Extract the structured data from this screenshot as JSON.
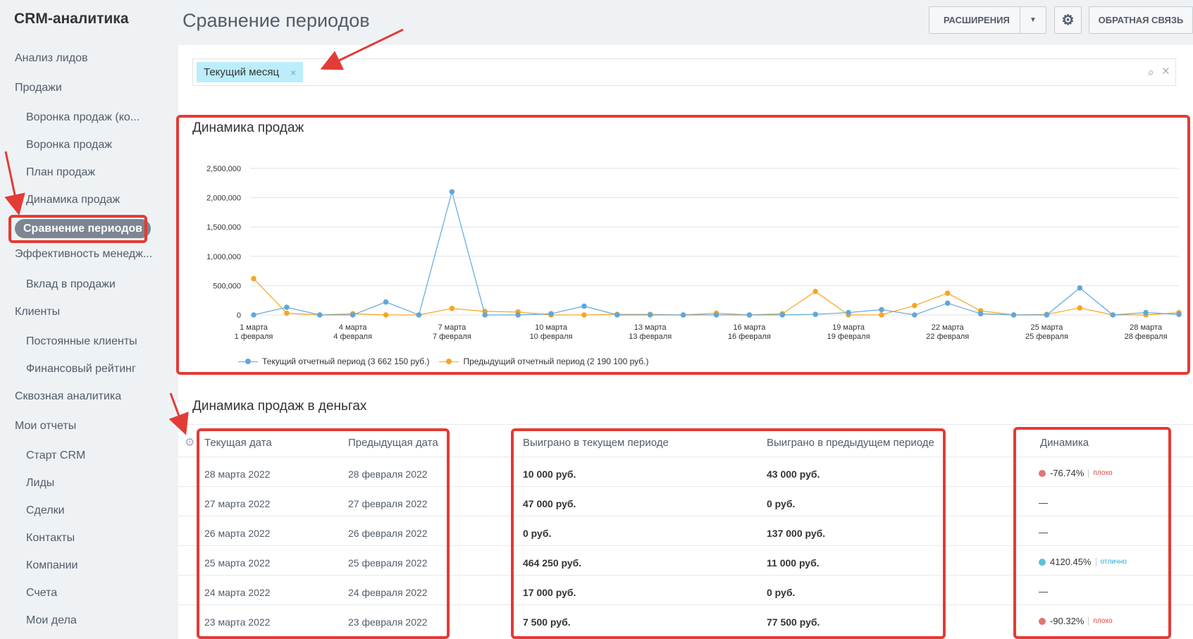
{
  "app_title": "CRM-аналитика",
  "page_title": "Сравнение периодов",
  "header": {
    "extensions_label": "РАСШИРЕНИЯ",
    "feedback_label": "ОБРАТНАЯ СВЯЗЬ"
  },
  "sidebar": {
    "items": [
      {
        "label": "Анализ лидов",
        "level": 1
      },
      {
        "label": "Продажи",
        "level": 1
      },
      {
        "label": "Воронка продаж (ко...",
        "level": 2
      },
      {
        "label": "Воронка продаж",
        "level": 2
      },
      {
        "label": "План продаж",
        "level": 2
      },
      {
        "label": "Динамика продаж",
        "level": 2
      },
      {
        "label": "Сравнение периодов",
        "level": 2,
        "active": true
      },
      {
        "label": "Эффективность менедж...",
        "level": 1
      },
      {
        "label": "Вклад в продажи",
        "level": 2
      },
      {
        "label": "Клиенты",
        "level": 1
      },
      {
        "label": "Постоянные клиенты",
        "level": 2
      },
      {
        "label": "Финансовый рейтинг",
        "level": 2
      },
      {
        "label": "Сквозная аналитика",
        "level": 1
      },
      {
        "label": "Мои отчеты",
        "level": 1
      },
      {
        "label": "Старт CRM",
        "level": 2
      },
      {
        "label": "Лиды",
        "level": 2
      },
      {
        "label": "Сделки",
        "level": 2
      },
      {
        "label": "Контакты",
        "level": 2
      },
      {
        "label": "Компании",
        "level": 2
      },
      {
        "label": "Счета",
        "level": 2
      },
      {
        "label": "Мои дела",
        "level": 2
      }
    ]
  },
  "filter": {
    "tag": "Текущий месяц"
  },
  "chart_section_title": "Динамика продаж",
  "chart_data": {
    "type": "line",
    "title": "Динамика продаж",
    "x_labels_top": [
      "1 марта",
      "4 марта",
      "7 марта",
      "10 марта",
      "13 марта",
      "16 марта",
      "19 марта",
      "22 марта",
      "25 марта",
      "28 марта"
    ],
    "x_labels_bottom": [
      "1 февраля",
      "4 февраля",
      "7 февраля",
      "10 февраля",
      "13 февраля",
      "16 февраля",
      "19 февраля",
      "22 февраля",
      "25 февраля",
      "28 февраля"
    ],
    "y_ticks": [
      "0",
      "500,000",
      "1,000,000",
      "1,500,000",
      "2,000,000",
      "2,500,000"
    ],
    "ylim": [
      0,
      2500000
    ],
    "series": [
      {
        "name": "Текущий отчетный период (3 662 150 руб.)",
        "color": "#5fa8dc",
        "values": [
          0,
          130000,
          0,
          0,
          220000,
          0,
          2100000,
          0,
          0,
          20000,
          150000,
          0,
          0,
          0,
          0,
          0,
          0,
          10000,
          40000,
          90000,
          0,
          200000,
          20000,
          0,
          0,
          460000,
          0,
          40000,
          10000
        ]
      },
      {
        "name": "Предыдущий отчетный период (2 190 100 руб.)",
        "color": "#f5a623",
        "values": [
          620000,
          30000,
          0,
          20000,
          0,
          0,
          110000,
          60000,
          50000,
          0,
          0,
          10000,
          10000,
          0,
          30000,
          0,
          20000,
          400000,
          0,
          0,
          160000,
          370000,
          70000,
          0,
          10000,
          120000,
          0,
          0,
          40000
        ]
      }
    ],
    "grid": true,
    "legend": "bottom-left"
  },
  "table_section_title": "Динамика продаж в деньгах",
  "table": {
    "headers": [
      "Текущая дата",
      "Предыдущая дата",
      "Выиграно в текущем периоде",
      "Выиграно в предыдущем периоде",
      "Динамика"
    ],
    "rows": [
      {
        "cur": "28 марта 2022",
        "prev": "28 февраля 2022",
        "won_cur": "10 000 руб.",
        "won_prev": "43 000 руб.",
        "dyn": "-76.74%",
        "label": "плохо",
        "status": "bad"
      },
      {
        "cur": "27 марта 2022",
        "prev": "27 февраля 2022",
        "won_cur": "47 000 руб.",
        "won_prev": "0 руб.",
        "dyn": "—",
        "label": "",
        "status": "none"
      },
      {
        "cur": "26 марта 2022",
        "prev": "26 февраля 2022",
        "won_cur": "0 руб.",
        "won_prev": "137 000 руб.",
        "dyn": "—",
        "label": "",
        "status": "none"
      },
      {
        "cur": "25 марта 2022",
        "prev": "25 февраля 2022",
        "won_cur": "464 250 руб.",
        "won_prev": "11 000 руб.",
        "dyn": "4120.45%",
        "label": "отлично",
        "status": "good"
      },
      {
        "cur": "24 марта 2022",
        "prev": "24 февраля 2022",
        "won_cur": "17 000 руб.",
        "won_prev": "0 руб.",
        "dyn": "—",
        "label": "",
        "status": "none"
      },
      {
        "cur": "23 марта 2022",
        "prev": "23 февраля 2022",
        "won_cur": "7 500 руб.",
        "won_prev": "77 500 руб.",
        "dyn": "-90.32%",
        "label": "плохо",
        "status": "bad"
      }
    ]
  },
  "colors": {
    "bad": "#e57373",
    "good": "#5bc0de",
    "bad_text": "#e53935",
    "good_text": "#29a8d8",
    "frame": "#e33b35"
  }
}
